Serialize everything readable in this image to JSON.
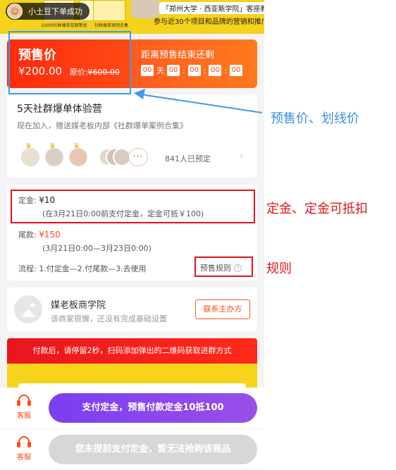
{
  "banner": {
    "tagline": "「郑州大学 · 西亚斯学院」客座教授",
    "subline": "参与近30个项目和品牌的营销和推广",
    "book_captions": [
      "100份社群爆单前期策划",
      "社群爆单案例合集"
    ]
  },
  "toast": {
    "text": "小土豆下单成功"
  },
  "presale": {
    "title": "预售价",
    "price": "¥200.00",
    "original_label": "原价:",
    "original_price": "¥600.00",
    "countdown_title": "距离预售结束还剩",
    "countdown": {
      "days": "00",
      "day_unit": "天",
      "hours": "00",
      "minutes": "00",
      "seconds": "00",
      "ms": "00"
    }
  },
  "course": {
    "name": "5天社群爆单体验营",
    "description": "现在加入，赠送媒老板内部《社群爆单案例合集》",
    "more": "···",
    "booked": "841人已预定"
  },
  "deposit": {
    "deposit_label": "定金:",
    "deposit_amount": "¥10",
    "deposit_note": "(在3月21日0:00前支付定金，定金可抵￥100)",
    "balance_label": "尾款:",
    "balance_amount": "¥150",
    "balance_note": "(3月21日0:00—3月23日0:00)",
    "flow": "流程: 1.付定金—2.付尾款—3.去使用",
    "rules": "预售规则"
  },
  "merchant": {
    "name": "媒老板商学院",
    "description": "该商家很懒，还没有完成基础设置",
    "contact": "联系主办方"
  },
  "notice": "付款后，请停留2秒，扫码添加弹出的二维码获取进群方式",
  "bottom": {
    "service_label": "客服",
    "pay_button": "支付定金，预售付款定金10抵100",
    "disabled_button": "您未提前支付定金，暂无法抢购该商品"
  },
  "annotations": {
    "presale_note": "预售价、划线价",
    "deposit_note": "定金、定金可抵扣",
    "rules_note": "规则"
  },
  "colors": {
    "accent": "#ff4a15",
    "purple": "#8a46ec",
    "annotation_red": "#e0151b",
    "annotation_blue": "#3d8fe2"
  }
}
